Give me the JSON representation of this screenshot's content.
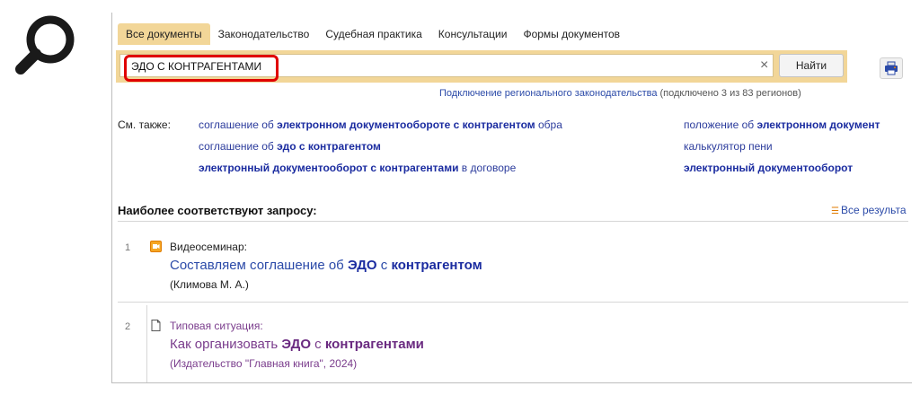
{
  "tabs": [
    "Все документы",
    "Законодательство",
    "Судебная практика",
    "Консультации",
    "Формы документов"
  ],
  "search": {
    "query": "ЭДО С КОНТРАГЕНТАМИ",
    "clear": "×",
    "button": "Найти"
  },
  "regions": {
    "link": "Подключение регионального законодательства",
    "count": "(подключено 3 из 83 регионов)"
  },
  "see_also": {
    "label": "См. также:",
    "items": [
      {
        "pre": "соглашение об ",
        "bold": "электронном документообороте с контрагентом",
        "post": " обра"
      },
      {
        "pre": "соглашение об ",
        "bold": "эдо с контрагентом",
        "post": ""
      },
      {
        "pre": "",
        "bold": "электронный документооборот с контрагентами",
        "post": " в договоре"
      },
      {
        "pre": "положение об ",
        "bold": "электронном документ",
        "post": ""
      },
      {
        "pre": "калькулятор пени",
        "bold": "",
        "post": ""
      },
      {
        "pre": "",
        "bold": "электронный документооборот",
        "post": ""
      }
    ]
  },
  "best": {
    "heading": "Наиболее соответствуют запросу:",
    "all_results": "Все результа"
  },
  "results": [
    {
      "num": "1",
      "type": "Видеосеминар:",
      "title_pre": "Составляем соглашение об ",
      "title_b1": "ЭДО",
      "title_mid": " с ",
      "title_b2": "контрагентом",
      "source": "(Климова М. А.)",
      "icon": "video-icon"
    },
    {
      "num": "2",
      "type": "Типовая ситуация:",
      "title_pre": "Как организовать ",
      "title_b1": "ЭДО",
      "title_mid": " с ",
      "title_b2": "контрагентами",
      "source": "(Издательство \"Главная книга\", 2024)",
      "icon": "document-icon"
    }
  ],
  "colors": {
    "tab_active": "#f2d698",
    "link": "#2b4aa8",
    "visited": "#7a3c8c",
    "highlight_border": "#e00000"
  }
}
